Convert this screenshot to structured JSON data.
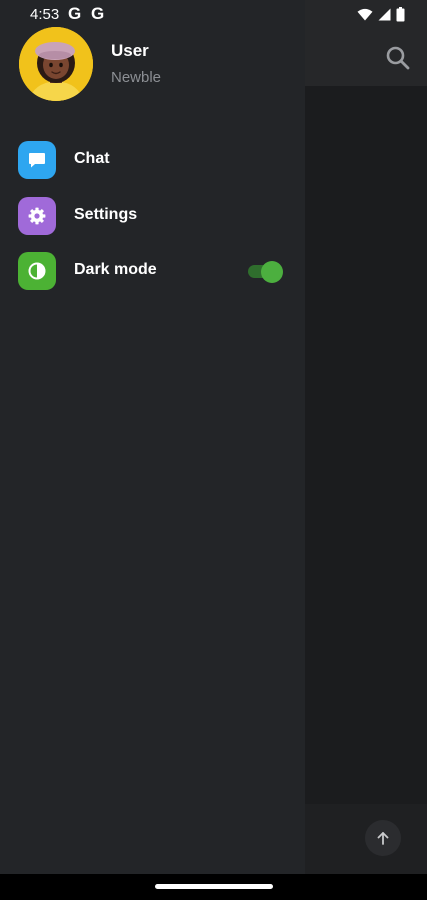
{
  "status_bar": {
    "time": "4:53",
    "google_icons": [
      "G",
      "G"
    ],
    "wifi_icon": "wifi-icon",
    "signal_icon": "cell-signal-icon",
    "battery_icon": "battery-icon"
  },
  "profile": {
    "name": "User",
    "role": "Newble",
    "avatar_icon": "avatar-illustration"
  },
  "menu": {
    "items": [
      {
        "label": "Chat",
        "icon": "chat-bubble-icon",
        "icon_color": "#2ea6f0"
      },
      {
        "label": "Settings",
        "icon": "gear-icon",
        "icon_color": "#a06ad9"
      },
      {
        "label": "Dark mode",
        "icon": "contrast-icon",
        "icon_color": "#4cb234",
        "toggle_on": true
      }
    ]
  },
  "background_app": {
    "search_icon": "search-icon",
    "scroll_up_icon": "arrow-up-icon"
  },
  "colors": {
    "drawer_bg": "#232528",
    "toggle_accent": "#4caf3f",
    "secondary_text": "#8c8f94"
  }
}
